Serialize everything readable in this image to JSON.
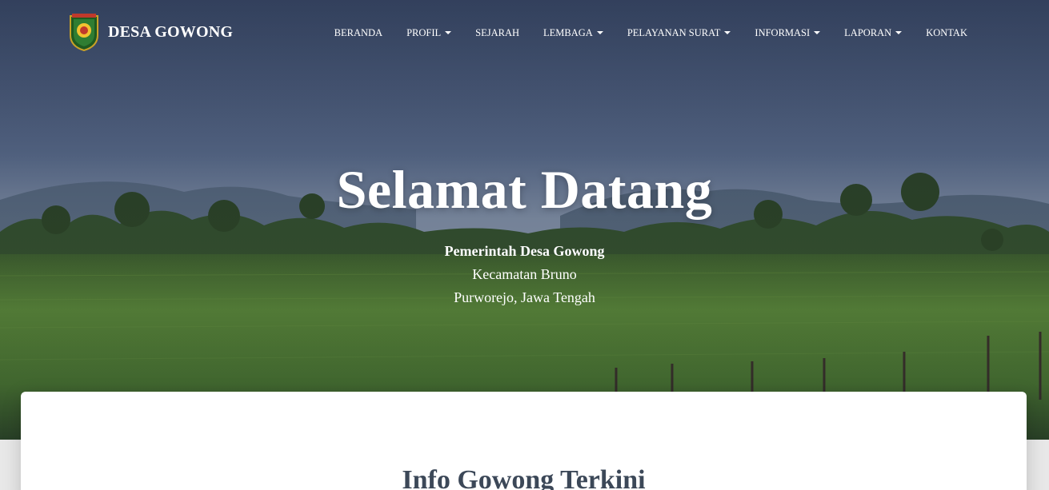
{
  "brand": {
    "title": "DESA GOWONG",
    "logo_icon": "village-emblem-icon"
  },
  "nav": {
    "items": [
      {
        "label": "BERANDA",
        "dropdown": false
      },
      {
        "label": "PROFIL",
        "dropdown": true
      },
      {
        "label": "SEJARAH",
        "dropdown": false
      },
      {
        "label": "LEMBAGA",
        "dropdown": true
      },
      {
        "label": "PELAYANAN SURAT",
        "dropdown": true
      },
      {
        "label": "INFORMASI",
        "dropdown": true
      },
      {
        "label": "LAPORAN",
        "dropdown": true
      },
      {
        "label": "KONTAK",
        "dropdown": false
      }
    ]
  },
  "hero": {
    "title": "Selamat Datang",
    "line1": "Pemerintah Desa Gowong",
    "line2": "Kecamatan Bruno",
    "line3": "Purworejo, Jawa Tengah"
  },
  "section": {
    "title": "Info Gowong Terkini"
  },
  "colors": {
    "overlay": "#3a4a66",
    "card_title": "#3c4858",
    "field_green": "#4f7a2a"
  }
}
